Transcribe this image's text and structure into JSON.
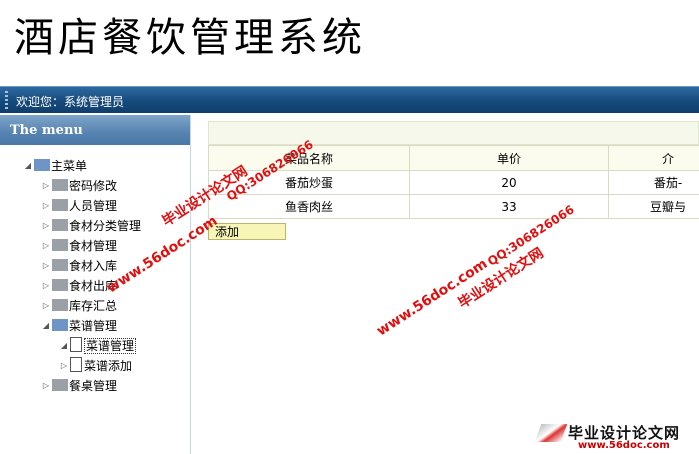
{
  "app": {
    "title": "酒店餐饮管理系统"
  },
  "topbar": {
    "welcome": "欢迎您：系统管理员"
  },
  "sidebar": {
    "header": "The menu",
    "root": {
      "label": "主菜单",
      "toggle": "◢"
    },
    "items": [
      {
        "label": "密码修改",
        "toggle": "▷"
      },
      {
        "label": "人员管理",
        "toggle": "▷"
      },
      {
        "label": "食材分类管理",
        "toggle": "▷"
      },
      {
        "label": "食材管理",
        "toggle": "▷"
      },
      {
        "label": "食材入库",
        "toggle": "▷"
      },
      {
        "label": "食材出库",
        "toggle": "▷"
      },
      {
        "label": "库存汇总",
        "toggle": "▷"
      },
      {
        "label": "菜谱管理",
        "toggle": "◢"
      },
      {
        "label": "菜谱管理",
        "toggle": "◢"
      },
      {
        "label": "菜谱添加",
        "toggle": "▷"
      },
      {
        "label": "餐桌管理",
        "toggle": "▷"
      }
    ]
  },
  "table": {
    "headers": [
      "菜品名称",
      "单价",
      "介"
    ],
    "rows": [
      [
        "番茄炒蛋",
        "20",
        "番茄-"
      ],
      [
        "鱼香肉丝",
        "33",
        "豆瓣与"
      ]
    ]
  },
  "actions": {
    "add_label": "添加"
  },
  "watermarks": {
    "cn": "毕业设计论文网",
    "url": "www.56doc.com",
    "qq": "QQ:306826066"
  },
  "logo": {
    "cn": "毕业设计论文网",
    "url": "www.56doc.com"
  }
}
